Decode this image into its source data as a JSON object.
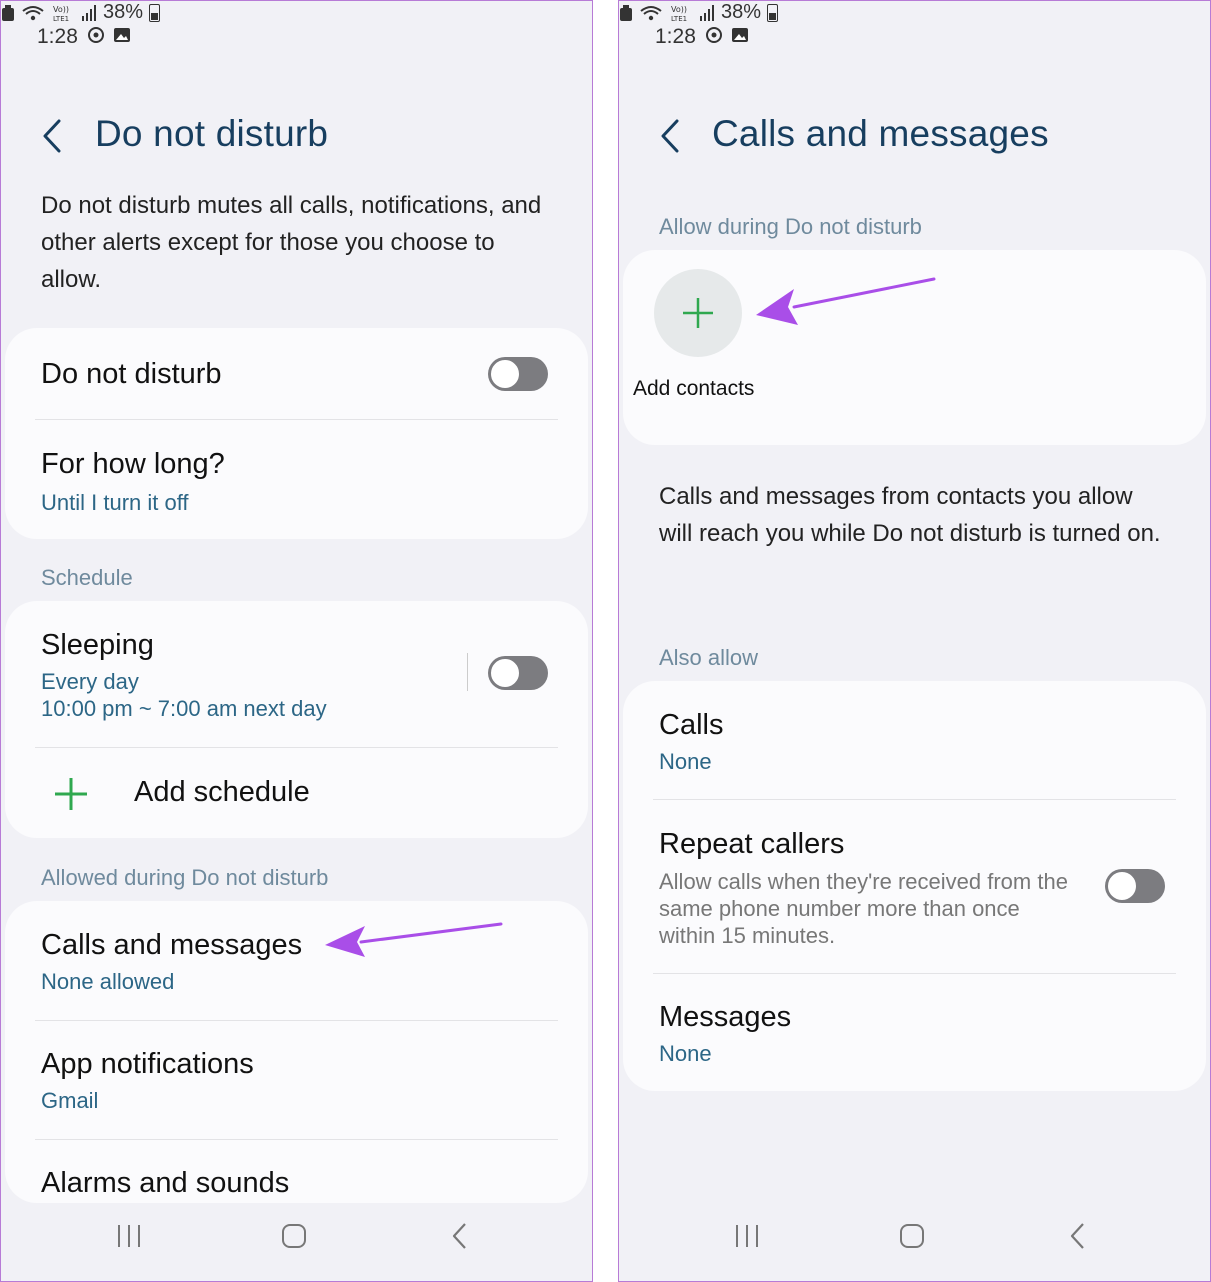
{
  "left": {
    "status": {
      "time": "1:28",
      "battery": "38%"
    },
    "title": "Do not disturb",
    "description": "Do not disturb mutes all calls, notifications, and other alerts except for those you choose to allow.",
    "dnd_label": "Do not disturb",
    "dnd_enabled": false,
    "duration_title": "For how long?",
    "duration_value": "Until I turn it off",
    "schedule_header": "Schedule",
    "sleeping_title": "Sleeping",
    "sleeping_days": "Every day",
    "sleeping_time": "10:00 pm ~ 7:00 am next day",
    "sleeping_enabled": false,
    "add_schedule": "Add schedule",
    "allowed_header": "Allowed during Do not disturb",
    "calls_messages_title": "Calls and messages",
    "calls_messages_value": "None allowed",
    "app_notif_title": "App notifications",
    "app_notif_value": "Gmail",
    "alarms_title": "Alarms and sounds"
  },
  "right": {
    "status": {
      "time": "1:28",
      "battery": "38%"
    },
    "title": "Calls and messages",
    "allow_header": "Allow during Do not disturb",
    "add_contacts": "Add contacts",
    "description": "Calls and messages from contacts you allow will reach you while Do not disturb is turned on.",
    "also_allow_header": "Also allow",
    "calls_title": "Calls",
    "calls_value": "None",
    "repeat_title": "Repeat callers",
    "repeat_desc": "Allow calls when they're received from the same phone number more than once within 15 minutes.",
    "repeat_enabled": false,
    "messages_title": "Messages",
    "messages_value": "None"
  },
  "colors": {
    "arrow": "#a94ee8",
    "plus": "#2fa84f",
    "title": "#173e5f",
    "subtext": "#2c6686"
  },
  "icons": [
    "back-chevron-icon",
    "plus-icon",
    "arrow-annotation",
    "recents-icon",
    "home-icon",
    "nav-back-icon"
  ]
}
